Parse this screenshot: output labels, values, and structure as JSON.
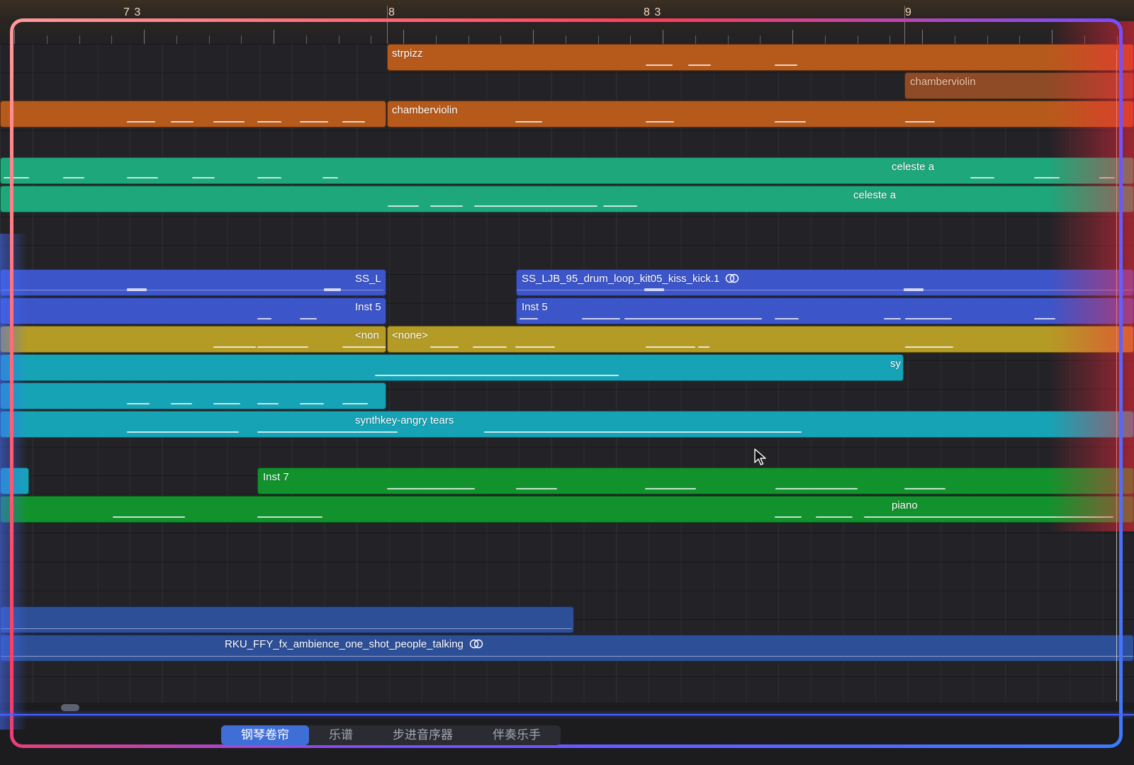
{
  "ruler": {
    "markers": [
      "7 3",
      "8",
      "8 3",
      "9"
    ]
  },
  "tracks": {
    "regions": [
      {
        "name": "strpizz",
        "color": "#b65a1b"
      },
      {
        "name": "chamberviolin",
        "color": "#8f4a26"
      },
      {
        "name": "",
        "color": "#b65a1b"
      },
      {
        "name": "chamberviolin",
        "color": "#b65a1b"
      },
      {
        "name": "celeste a",
        "color": "#1ea77a"
      },
      {
        "name": "celeste a",
        "color": "#1ea77a"
      },
      {
        "name": "SS_L",
        "color": "#3c55c9"
      },
      {
        "name": "SS_LJB_95_drum_loop_kit05_kiss_kick.1",
        "color": "#3c55c9",
        "icon": "stereo-link-icon"
      },
      {
        "name": "Inst 5",
        "color": "#3c55c9"
      },
      {
        "name": "Inst 5",
        "color": "#3c55c9"
      },
      {
        "name": "<non",
        "color": "#b49b26"
      },
      {
        "name": "<none>",
        "color": "#b49b26"
      },
      {
        "name": "sy",
        "color": "#16a3b6"
      },
      {
        "name": "",
        "color": "#16a3b6"
      },
      {
        "name": "synthkey-angry tears",
        "color": "#16a3b6"
      },
      {
        "name": "",
        "color": "#16a3b6"
      },
      {
        "name": "Inst 7",
        "color": "#12922d"
      },
      {
        "name": "piano",
        "color": "#12922d"
      },
      {
        "name": "",
        "color": "#2d4f98"
      },
      {
        "name": "RKU_FFY_fx_ambience_one_shot_people_talking",
        "color": "#2d4f98",
        "icon": "stereo-link-icon"
      }
    ]
  },
  "editor_tabs": {
    "items": [
      {
        "label": "钢琴卷帘",
        "active": true
      },
      {
        "label": "乐谱",
        "active": false
      },
      {
        "label": "步进音序器",
        "active": false
      },
      {
        "label": "伴奏乐手",
        "active": false
      }
    ]
  },
  "colors": {
    "accent": "#3f6fd6",
    "glow_red": "#ff3d5a",
    "glow_blue": "#3b7bff"
  }
}
